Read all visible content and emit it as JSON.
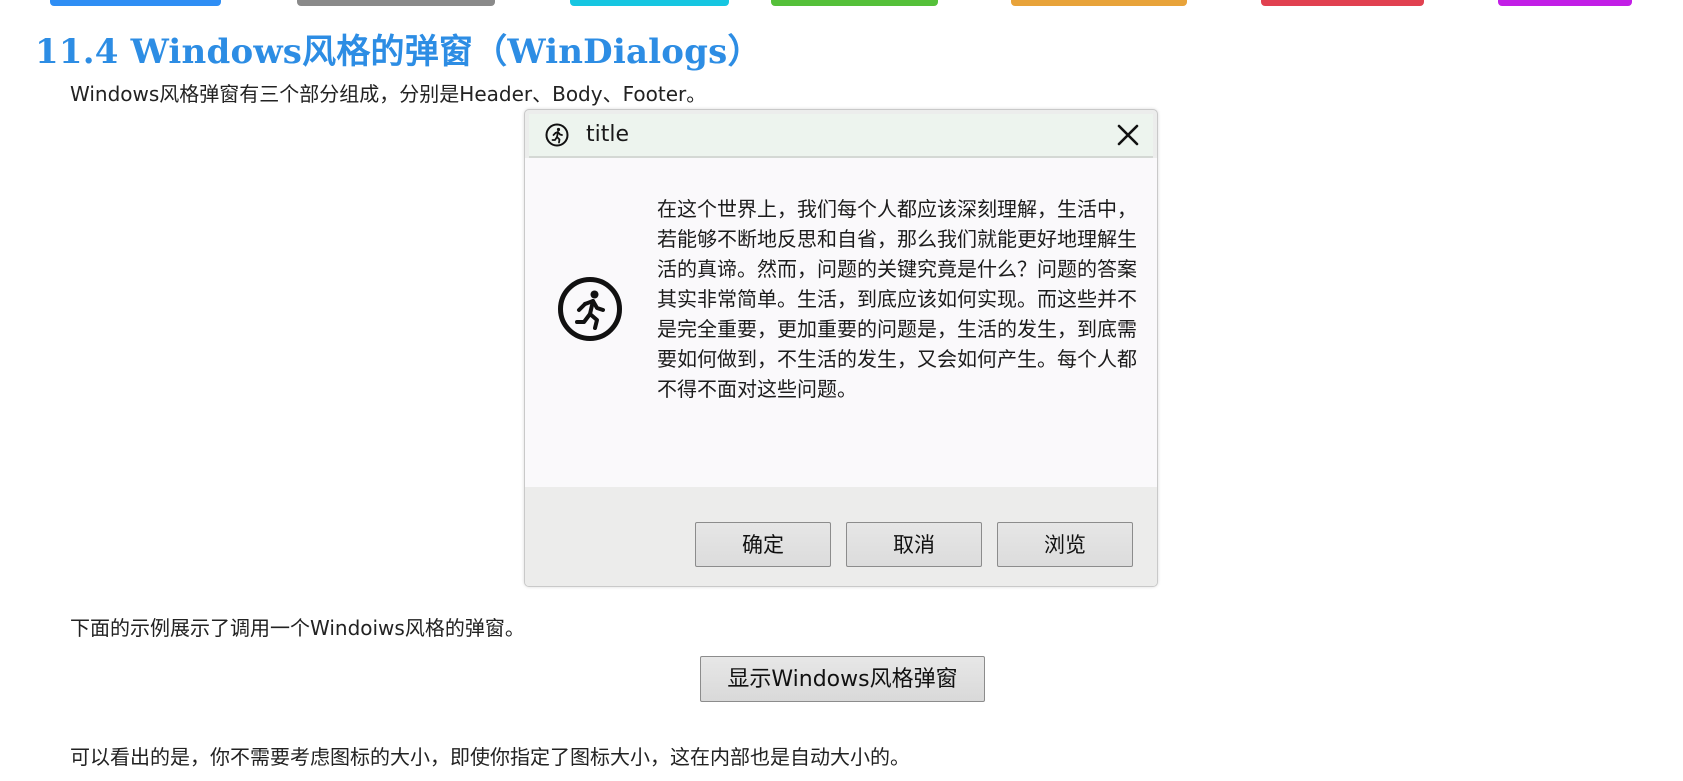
{
  "top_tabs": {
    "colors": [
      "#2f8ef4",
      "#8a8a8a",
      "#16c6e1",
      "#55c03a",
      "#e8a33a",
      "#e14150",
      "#c21ee6"
    ]
  },
  "section": {
    "title": "11.4 Windows风格的弹窗（WinDialogs）",
    "intro": "Windows风格弹窗有三个部分组成，分别是Header、Body、Footer。"
  },
  "dialog": {
    "header_icon": "running-person-icon",
    "title": "title",
    "close_icon": "close-icon",
    "body_icon": "running-person-circle-icon",
    "message": "在这个世界上，我们每个人都应该深刻理解，生活中，若能够不断地反思和自省，那么我们就能更好地理解生活的真谛。然而，问题的关键究竟是什么？问题的答案其实非常简单。生活，到底应该如何实现。而这些并不是完全重要，更加重要的问题是，生活的发生，到底需要如何做到，不生活的发生，又会如何产生。每个人都不得不面对这些问题。",
    "buttons": {
      "ok": "确定",
      "cancel": "取消",
      "browse": "浏览"
    }
  },
  "example": {
    "text": "下面的示例展示了调用一个Windoiws风格的弹窗。",
    "show_button": "显示Windows风格弹窗"
  },
  "conclusion": {
    "text": "可以看出的是，你不需要考虑图标的大小，即使你指定了图标大小，这在内部也是自动大小的。"
  }
}
